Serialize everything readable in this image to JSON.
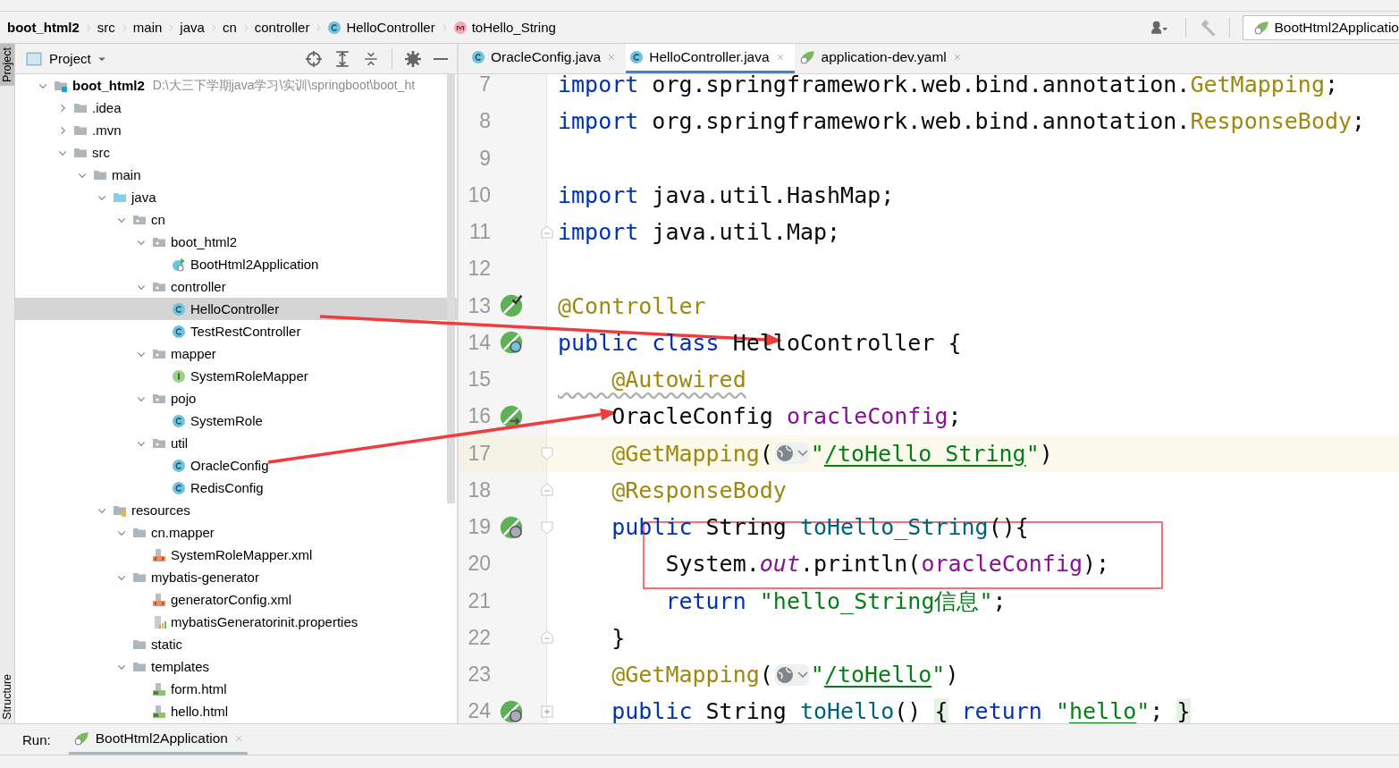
{
  "breadcrumb": [
    {
      "label": "boot_html2",
      "kind": "project"
    },
    {
      "label": "src",
      "kind": "folder"
    },
    {
      "label": "main",
      "kind": "folder"
    },
    {
      "label": "java",
      "kind": "folder"
    },
    {
      "label": "cn",
      "kind": "folder"
    },
    {
      "label": "controller",
      "kind": "folder"
    },
    {
      "label": "HelloController",
      "kind": "class"
    },
    {
      "label": "toHello_String",
      "kind": "method"
    }
  ],
  "run_config": {
    "label": "BootHtml2Applicatio"
  },
  "side_tools": [
    {
      "label": "Project",
      "selected": true
    },
    {
      "label": "Structure",
      "selected": false
    }
  ],
  "project_panel": {
    "title": "Project",
    "tree": [
      {
        "label": "boot_html2",
        "path": "D:\\大三下学期java学习\\实训\\springboot\\boot_ht",
        "kind": "module",
        "expanded": true,
        "selected": false,
        "children": [
          {
            "label": ".idea",
            "kind": "folder",
            "expanded": false,
            "selected": false
          },
          {
            "label": ".mvn",
            "kind": "folder",
            "expanded": false,
            "selected": false
          },
          {
            "label": "src",
            "kind": "folder",
            "expanded": true,
            "selected": false,
            "children": [
              {
                "label": "main",
                "kind": "folder",
                "expanded": true,
                "selected": false,
                "children": [
                  {
                    "label": "java",
                    "kind": "source",
                    "expanded": true,
                    "selected": false,
                    "children": [
                      {
                        "label": "cn",
                        "kind": "package",
                        "expanded": true,
                        "selected": false,
                        "children": [
                          {
                            "label": "boot_html2",
                            "kind": "package",
                            "expanded": true,
                            "selected": false,
                            "children": [
                              {
                                "label": "BootHtml2Application",
                                "kind": "app",
                                "selected": false
                              }
                            ]
                          },
                          {
                            "label": "controller",
                            "kind": "package",
                            "expanded": true,
                            "selected": false,
                            "children": [
                              {
                                "label": "HelloController",
                                "kind": "class",
                                "selected": true
                              },
                              {
                                "label": "TestRestController",
                                "kind": "class",
                                "selected": false
                              }
                            ]
                          },
                          {
                            "label": "mapper",
                            "kind": "package",
                            "expanded": true,
                            "selected": false,
                            "children": [
                              {
                                "label": "SystemRoleMapper",
                                "kind": "interface",
                                "selected": false
                              }
                            ]
                          },
                          {
                            "label": "pojo",
                            "kind": "package",
                            "expanded": true,
                            "selected": false,
                            "children": [
                              {
                                "label": "SystemRole",
                                "kind": "class",
                                "selected": false
                              }
                            ]
                          },
                          {
                            "label": "util",
                            "kind": "package",
                            "expanded": true,
                            "selected": false,
                            "children": [
                              {
                                "label": "OracleConfig",
                                "kind": "class",
                                "selected": false
                              },
                              {
                                "label": "RedisConfig",
                                "kind": "class",
                                "selected": false
                              }
                            ]
                          }
                        ]
                      }
                    ]
                  },
                  {
                    "label": "resources",
                    "kind": "resources",
                    "expanded": true,
                    "selected": false,
                    "children": [
                      {
                        "label": "cn.mapper",
                        "kind": "folder",
                        "expanded": true,
                        "selected": false,
                        "children": [
                          {
                            "label": "SystemRoleMapper.xml",
                            "kind": "xml",
                            "selected": false
                          }
                        ]
                      },
                      {
                        "label": "mybatis-generator",
                        "kind": "folder",
                        "expanded": true,
                        "selected": false,
                        "children": [
                          {
                            "label": "generatorConfig.xml",
                            "kind": "xml",
                            "selected": false
                          },
                          {
                            "label": "mybatisGeneratorinit.properties",
                            "kind": "properties",
                            "selected": false
                          }
                        ]
                      },
                      {
                        "label": "static",
                        "kind": "folder",
                        "selected": false
                      },
                      {
                        "label": "templates",
                        "kind": "folder",
                        "expanded": true,
                        "selected": false,
                        "children": [
                          {
                            "label": "form.html",
                            "kind": "html",
                            "selected": false
                          },
                          {
                            "label": "hello.html",
                            "kind": "html",
                            "selected": false
                          }
                        ]
                      }
                    ]
                  }
                ]
              }
            ]
          }
        ]
      }
    ]
  },
  "editor_tabs": [
    {
      "label": "OracleConfig.java",
      "kind": "class",
      "selected": false
    },
    {
      "label": "HelloController.java",
      "kind": "class",
      "selected": true
    },
    {
      "label": "application-dev.yaml",
      "kind": "yaml",
      "selected": false
    }
  ],
  "code_lines": [
    {
      "number": "7",
      "current": false,
      "segments": [
        {
          "kind": "kw",
          "text": "import"
        },
        {
          "kind": "plain",
          "text": " org.springframework.web.bind.annotation."
        },
        {
          "kind": "anno",
          "text": "GetMapping"
        },
        {
          "kind": "plain",
          "text": ";"
        }
      ]
    },
    {
      "number": "8",
      "current": false,
      "segments": [
        {
          "kind": "kw",
          "text": "import"
        },
        {
          "kind": "plain",
          "text": " org.springframework.web.bind.annotation."
        },
        {
          "kind": "anno",
          "text": "ResponseBody"
        },
        {
          "kind": "plain",
          "text": ";"
        }
      ]
    },
    {
      "number": "9",
      "current": false
    },
    {
      "number": "10",
      "current": false,
      "segments": [
        {
          "kind": "kw",
          "text": "import"
        },
        {
          "kind": "plain",
          "text": " java.util.HashMap;"
        }
      ]
    },
    {
      "number": "11",
      "current": false,
      "fold_marker": {
        "kind": "end"
      },
      "segments": [
        {
          "kind": "kw",
          "text": "import"
        },
        {
          "kind": "plain",
          "text": " java.util.Map;"
        }
      ]
    },
    {
      "number": "12",
      "current": false
    },
    {
      "number": "13",
      "current": false,
      "gutter_marker": {
        "kind": "bean-check"
      },
      "segments": [
        {
          "kind": "anno",
          "text": "@Controller"
        }
      ]
    },
    {
      "number": "14",
      "current": false,
      "gutter_marker": {
        "kind": "bean-search"
      },
      "segments": [
        {
          "kind": "kw",
          "text": "public class "
        },
        {
          "kind": "plain",
          "text": "HelloController {"
        }
      ]
    },
    {
      "number": "15",
      "current": false,
      "segments": [
        {
          "kind": "anno-warn",
          "text": "    @Autowired"
        }
      ]
    },
    {
      "number": "16",
      "current": false,
      "gutter_marker": {
        "kind": "bean-inject"
      },
      "segments": [
        {
          "kind": "plain",
          "text": "    OracleConfig "
        },
        {
          "kind": "field",
          "text": "oracleConfig"
        },
        {
          "kind": "plain",
          "text": ";"
        }
      ]
    },
    {
      "number": "17",
      "current": true,
      "fold_marker": {
        "kind": "start"
      },
      "segments": [
        {
          "kind": "anno",
          "text": "    @GetMapping"
        },
        {
          "kind": "plain",
          "text": "("
        },
        {
          "kind": "globe"
        },
        {
          "kind": "str",
          "text": "\""
        },
        {
          "kind": "url",
          "text": "/toHello_String"
        },
        {
          "kind": "str",
          "text": "\""
        },
        {
          "kind": "plain",
          "text": ")"
        }
      ]
    },
    {
      "number": "18",
      "current": false,
      "fold_marker": {
        "kind": "end"
      },
      "segments": [
        {
          "kind": "anno",
          "text": "    @ResponseBody"
        }
      ]
    },
    {
      "number": "19",
      "current": false,
      "gutter_marker": {
        "kind": "web"
      },
      "fold_marker": {
        "kind": "start"
      },
      "segments": [
        {
          "kind": "kw",
          "text": "    public"
        },
        {
          "kind": "plain",
          "text": " String "
        },
        {
          "kind": "method",
          "text": "toHello_String"
        },
        {
          "kind": "plain",
          "text": "(){"
        }
      ]
    },
    {
      "number": "20",
      "current": false,
      "segments": [
        {
          "kind": "plain",
          "text": "        System."
        },
        {
          "kind": "static",
          "text": "out"
        },
        {
          "kind": "plain",
          "text": ".println("
        },
        {
          "kind": "field",
          "text": "oracleConfig"
        },
        {
          "kind": "plain",
          "text": ");"
        }
      ]
    },
    {
      "number": "21",
      "current": false,
      "segments": [
        {
          "kind": "kw",
          "text": "        return "
        },
        {
          "kind": "str",
          "text": "\"hello_String信息\""
        },
        {
          "kind": "plain",
          "text": ";"
        }
      ]
    },
    {
      "number": "22",
      "current": false,
      "fold_marker": {
        "kind": "end"
      },
      "segments": [
        {
          "kind": "plain",
          "text": "    }"
        }
      ]
    },
    {
      "number": "23",
      "current": false,
      "segments": [
        {
          "kind": "anno",
          "text": "    @GetMapping"
        },
        {
          "kind": "plain",
          "text": "("
        },
        {
          "kind": "globe"
        },
        {
          "kind": "str",
          "text": "\""
        },
        {
          "kind": "url",
          "text": "/toHello"
        },
        {
          "kind": "str",
          "text": "\""
        },
        {
          "kind": "plain",
          "text": ")"
        }
      ]
    },
    {
      "number": "24",
      "current": false,
      "gutter_marker": {
        "kind": "web"
      },
      "fold_marker": {
        "kind": "collapsed"
      },
      "segments": [
        {
          "kind": "kw",
          "text": "    public"
        },
        {
          "kind": "plain",
          "text": " String "
        },
        {
          "kind": "method",
          "text": "toHello"
        },
        {
          "kind": "plain",
          "text": "() "
        },
        {
          "kind": "folded",
          "text": "{"
        },
        {
          "kind": "kw",
          "text": " return "
        },
        {
          "kind": "str",
          "text": "\""
        },
        {
          "kind": "url",
          "text": "hello"
        },
        {
          "kind": "str",
          "text": "\""
        },
        {
          "kind": "plain",
          "text": "; "
        },
        {
          "kind": "folded",
          "text": "}"
        }
      ]
    }
  ],
  "annotations": [
    {
      "kind": "arrow"
    },
    {
      "kind": "arrow"
    },
    {
      "kind": "box"
    }
  ],
  "run_bar": {
    "label": "Run:",
    "tabs": [
      {
        "label": "BootHtml2Application",
        "selected": true
      }
    ]
  }
}
